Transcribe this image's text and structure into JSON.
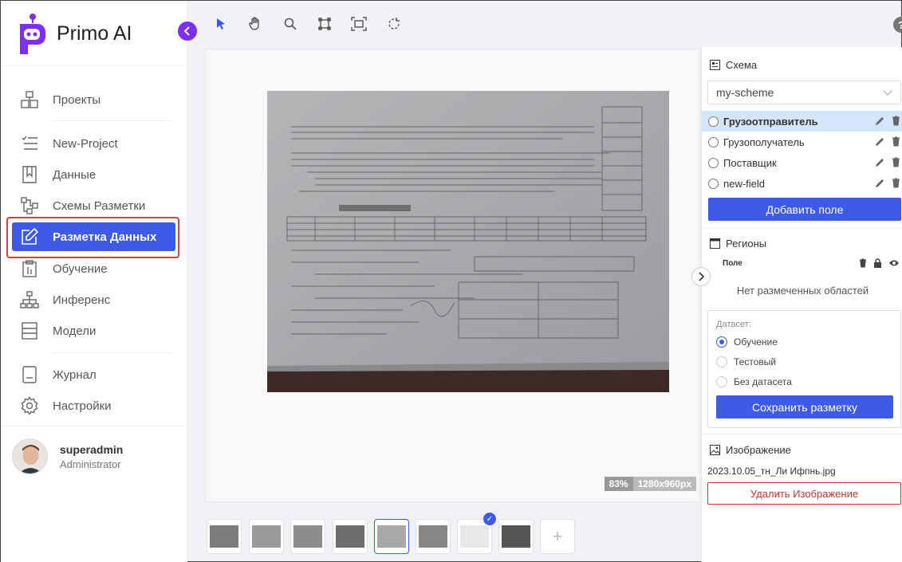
{
  "app": {
    "name": "Primo AI"
  },
  "colors": {
    "accent": "#3d5ae9",
    "brand": "#7b2ff7",
    "danger": "#c63434",
    "highlight": "#d9413d"
  },
  "sidebar": {
    "items": [
      {
        "label": "Проекты",
        "icon": "projects-icon"
      },
      {
        "label": "New-Project",
        "icon": "checklist-icon"
      },
      {
        "label": "Данные",
        "icon": "book-icon"
      },
      {
        "label": "Схемы Разметки",
        "icon": "schema-icon"
      },
      {
        "label": "Разметка Данных",
        "icon": "edit-icon",
        "active": true
      },
      {
        "label": "Обучение",
        "icon": "training-icon"
      },
      {
        "label": "Инференс",
        "icon": "hierarchy-icon"
      },
      {
        "label": "Модели",
        "icon": "models-icon"
      },
      {
        "label": "Журнал",
        "icon": "journal-icon"
      },
      {
        "label": "Настройки",
        "icon": "settings-icon"
      }
    ],
    "user": {
      "name": "superadmin",
      "role": "Administrator"
    }
  },
  "toolbar": {
    "tools": [
      "pointer-icon",
      "hand-icon",
      "zoom-icon",
      "crop-icon",
      "fit-icon",
      "rotate-icon"
    ],
    "help": "?"
  },
  "canvas": {
    "zoom": "83%",
    "resolution": "1280x960px"
  },
  "thumbnails": {
    "count": 8,
    "selected_index": 4,
    "checked_index": 6,
    "add_label": "+"
  },
  "panel": {
    "schema": {
      "title": "Схема",
      "selected": "my-scheme",
      "fields": [
        "Грузоотправитель",
        "Грузополучатель",
        "Поставщик",
        "new-field"
      ],
      "active_field_index": 0,
      "add_button": "Добавить поле"
    },
    "regions": {
      "title": "Регионы",
      "column_label": "Поле",
      "empty_text": "Нет размеченных областей"
    },
    "dataset": {
      "label": "Датасет:",
      "options": [
        "Обучение",
        "Тестовый",
        "Без датасета"
      ],
      "selected_index": 0,
      "save_button": "Сохранить разметку"
    },
    "image": {
      "title": "Изображение",
      "filename": "2023.10.05_тн_Ли Ифпнь.jpg",
      "delete_button": "Удалить Изображение"
    }
  }
}
